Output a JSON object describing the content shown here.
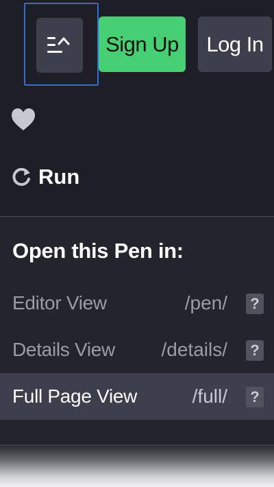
{
  "header": {
    "menu_toggle_icon": "editor-layout-icon",
    "signup_label": "Sign Up",
    "login_label": "Log In"
  },
  "actions": {
    "heart_icon": "heart-icon",
    "run_icon": "refresh-icon",
    "run_label": "Run"
  },
  "open_in": {
    "title": "Open this Pen in:",
    "views": [
      {
        "label": "Editor View",
        "path": "/pen/",
        "help": "?",
        "active": false
      },
      {
        "label": "Details View",
        "path": "/details/",
        "help": "?",
        "active": false
      },
      {
        "label": "Full Page View",
        "path": "/full/",
        "help": "?",
        "active": true
      }
    ]
  },
  "colors": {
    "background": "#1e1f26",
    "signup_button": "#47cf73",
    "secondary_button": "#3d3f4c",
    "focus_outline": "#2f6fd1"
  }
}
